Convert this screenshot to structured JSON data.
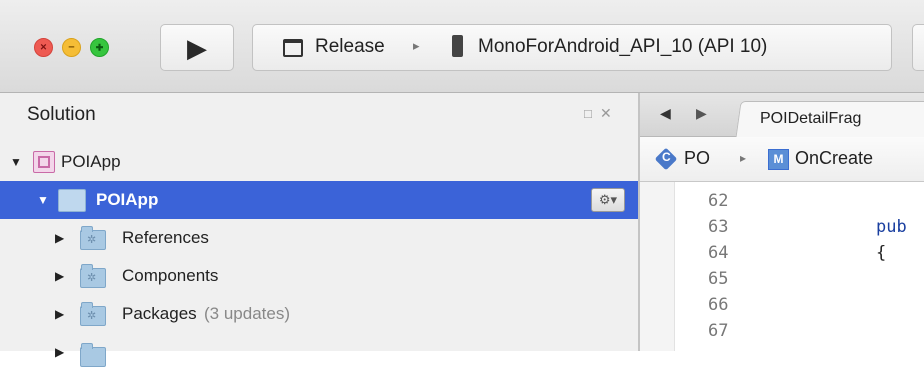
{
  "toolbar": {
    "run_label": "▶",
    "configuration": "Release",
    "separator": "▸",
    "device": "MonoForAndroid_API_10 (API 10)"
  },
  "solution_pad": {
    "title": "Solution",
    "controls": [
      "□",
      "✕"
    ],
    "items": [
      {
        "label": "POIApp",
        "kind": "solution"
      },
      {
        "label": "POIApp",
        "kind": "project",
        "selected": true
      },
      {
        "label": "References"
      },
      {
        "label": "Components"
      },
      {
        "label": "Packages",
        "suffix": "(3 updates)"
      },
      {
        "label": ""
      }
    ]
  },
  "editor": {
    "tab_label": "POIDetailFrag",
    "breadcrumb_class": "PO",
    "breadcrumb_method": "OnCreate",
    "lines": [
      {
        "num": "62",
        "code": ""
      },
      {
        "num": "63",
        "code": "pub"
      },
      {
        "num": "64",
        "code": "{"
      },
      {
        "num": "65",
        "code": ""
      },
      {
        "num": "66",
        "code": ""
      },
      {
        "num": "67",
        "code": ""
      }
    ]
  },
  "colors": {
    "selection": "#3b63d8",
    "accent_blue": "#3b6ed1"
  }
}
